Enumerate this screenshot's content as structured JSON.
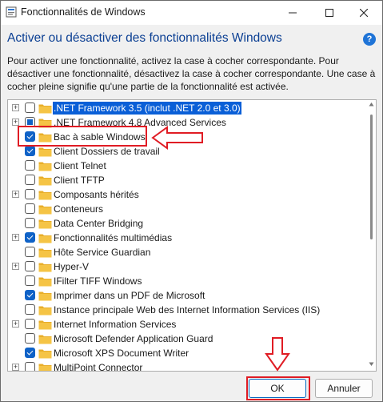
{
  "window": {
    "title": "Fonctionnalités de Windows",
    "controls": {
      "minimize": "—",
      "maximize": "☐",
      "close": "✕"
    }
  },
  "header": {
    "title": "Activer ou désactiver des fonctionnalités Windows",
    "help": "?"
  },
  "description": "Pour activer une fonctionnalité, activez la case à cocher correspondante. Pour désactiver une fonctionnalité, désactivez la case à cocher correspondante. Une case à cocher pleine signifie qu'une partie de la fonctionnalité est activée.",
  "features": [
    {
      "label": ".NET Framework 3.5 (inclut .NET 2.0 et 3.0)",
      "state": "unchecked",
      "expandable": true,
      "selected": true
    },
    {
      "label": ".NET Framework 4.8 Advanced Services",
      "state": "partial",
      "expandable": true,
      "selected": false
    },
    {
      "label": "Bac à sable Windows",
      "state": "checked",
      "expandable": false,
      "selected": false
    },
    {
      "label": "Client Dossiers de travail",
      "state": "checked",
      "expandable": false,
      "selected": false
    },
    {
      "label": "Client Telnet",
      "state": "unchecked",
      "expandable": false,
      "selected": false
    },
    {
      "label": "Client TFTP",
      "state": "unchecked",
      "expandable": false,
      "selected": false
    },
    {
      "label": "Composants hérités",
      "state": "unchecked",
      "expandable": true,
      "selected": false
    },
    {
      "label": "Conteneurs",
      "state": "unchecked",
      "expandable": false,
      "selected": false
    },
    {
      "label": "Data Center Bridging",
      "state": "unchecked",
      "expandable": false,
      "selected": false
    },
    {
      "label": "Fonctionnalités multimédias",
      "state": "checked",
      "expandable": true,
      "selected": false
    },
    {
      "label": "Hôte Service Guardian",
      "state": "unchecked",
      "expandable": false,
      "selected": false
    },
    {
      "label": "Hyper-V",
      "state": "unchecked",
      "expandable": true,
      "selected": false
    },
    {
      "label": "IFilter TIFF Windows",
      "state": "unchecked",
      "expandable": false,
      "selected": false
    },
    {
      "label": "Imprimer dans un PDF de Microsoft",
      "state": "checked",
      "expandable": false,
      "selected": false
    },
    {
      "label": "Instance principale Web des Internet Information Services (IIS)",
      "state": "unchecked",
      "expandable": false,
      "selected": false
    },
    {
      "label": "Internet Information Services",
      "state": "unchecked",
      "expandable": true,
      "selected": false
    },
    {
      "label": "Microsoft Defender Application Guard",
      "state": "unchecked",
      "expandable": false,
      "selected": false
    },
    {
      "label": "Microsoft XPS Document Writer",
      "state": "checked",
      "expandable": false,
      "selected": false
    },
    {
      "label": "MultiPoint Connector",
      "state": "unchecked",
      "expandable": true,
      "selected": false
    }
  ],
  "buttons": {
    "ok": "OK",
    "cancel": "Annuler"
  },
  "colors": {
    "accent": "#0067c0",
    "annotation": "#e01c24",
    "folder": "#f5c445"
  }
}
